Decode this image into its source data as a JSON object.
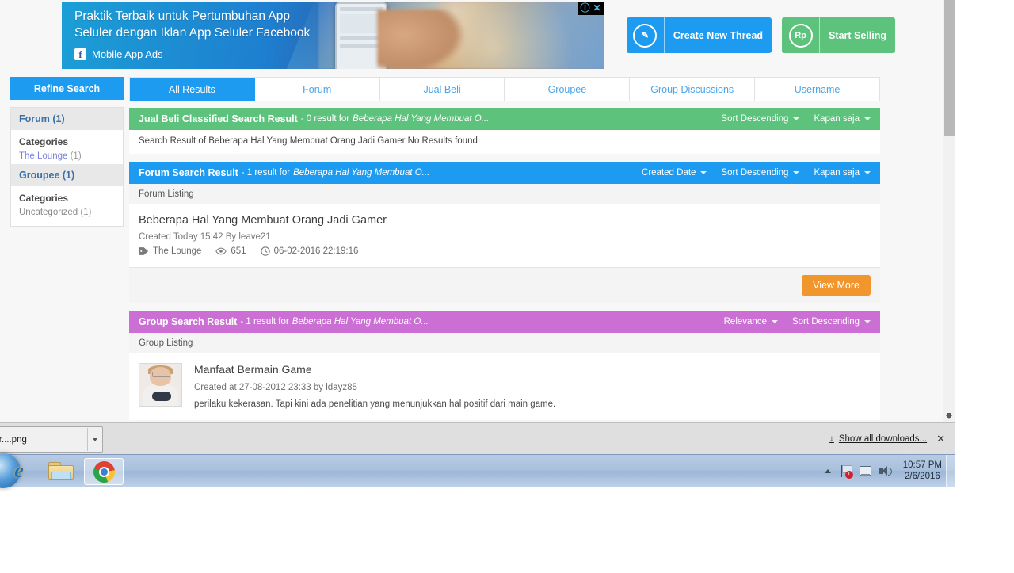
{
  "ad": {
    "line1": "Praktik Terbaik untuk Pertumbuhan App",
    "line2": "Seluler dengan Iklan App Seluler Facebook",
    "brand": "Mobile App Ads",
    "fb_glyph": "f",
    "info_icon": "ⓘ",
    "close_icon": "✕"
  },
  "header": {
    "create_thread_label": "Create New Thread",
    "create_thread_icon": "✎",
    "start_selling_label": "Start Selling",
    "start_selling_icon": "Rp"
  },
  "sidebar": {
    "refine_label": "Refine Search",
    "groups": [
      {
        "head": "Forum (1)",
        "cat_title": "Categories",
        "link": "The Lounge",
        "count": "(1)"
      },
      {
        "head": "Groupee (1)",
        "cat_title": "Categories",
        "link": "Uncategorized",
        "count": "(1)"
      }
    ]
  },
  "tabs": [
    {
      "label": "All Results",
      "active": true
    },
    {
      "label": "Forum",
      "active": false
    },
    {
      "label": "Jual Beli",
      "active": false
    },
    {
      "label": "Groupee",
      "active": false
    },
    {
      "label": "Group Discussions",
      "active": false
    },
    {
      "label": "Username",
      "active": false
    }
  ],
  "panels": {
    "jual": {
      "title": "Jual Beli Classified Search Result",
      "sub": "- 0 result for",
      "query": "Beberapa Hal Yang Membuat O...",
      "controls": [
        "Sort Descending",
        "Kapan saja"
      ],
      "note": "Search Result of Beberapa Hal Yang Membuat Orang Jadi Gamer No Results found",
      "color": "#5cc27c"
    },
    "forum": {
      "title": "Forum Search Result",
      "sub": "- 1 result for",
      "query": "Beberapa Hal Yang Membuat O...",
      "controls": [
        "Created Date",
        "Sort Descending",
        "Kapan saja"
      ],
      "listing_label": "Forum Listing",
      "color": "#1d9bf0",
      "results": [
        {
          "title": "Beberapa Hal Yang Membuat Orang Jadi Gamer",
          "meta": "Created Today 15:42 By leave21",
          "tag": "The Lounge",
          "views": "651",
          "date": "06-02-2016 22:19:16"
        }
      ],
      "view_more_label": "View More"
    },
    "group": {
      "title": "Group Search Result",
      "sub": "- 1 result for",
      "query": "Beberapa Hal Yang Membuat O...",
      "controls": [
        "Relevance",
        "Sort Descending"
      ],
      "listing_label": "Group Listing",
      "color": "#cb6fd4",
      "results": [
        {
          "title": "Manfaat Bermain Game",
          "meta": "Created at 27-08-2012 23:33 by ldayz85",
          "desc": "perilaku kekerasan. Tapi kini ada penelitian yang menunjukkan hal positif dari main game."
        }
      ]
    }
  },
  "download_bar": {
    "file_name": "s+an+art+for....png",
    "show_all_label": "Show all downloads...",
    "download_icon": "↓",
    "close_icon": "✕"
  },
  "taskbar": {
    "items": [
      {
        "name": "internet-explorer",
        "glyph": "e",
        "active": false
      },
      {
        "name": "file-explorer",
        "glyph": "",
        "active": false
      },
      {
        "name": "google-chrome",
        "glyph": "",
        "active": true
      }
    ],
    "clock_time": "10:57 PM",
    "clock_date": "2/6/2016"
  },
  "colors": {
    "blue": "#1d9bf0",
    "green": "#5cc27c",
    "purple": "#cb6fd4",
    "orange": "#f0962d"
  }
}
